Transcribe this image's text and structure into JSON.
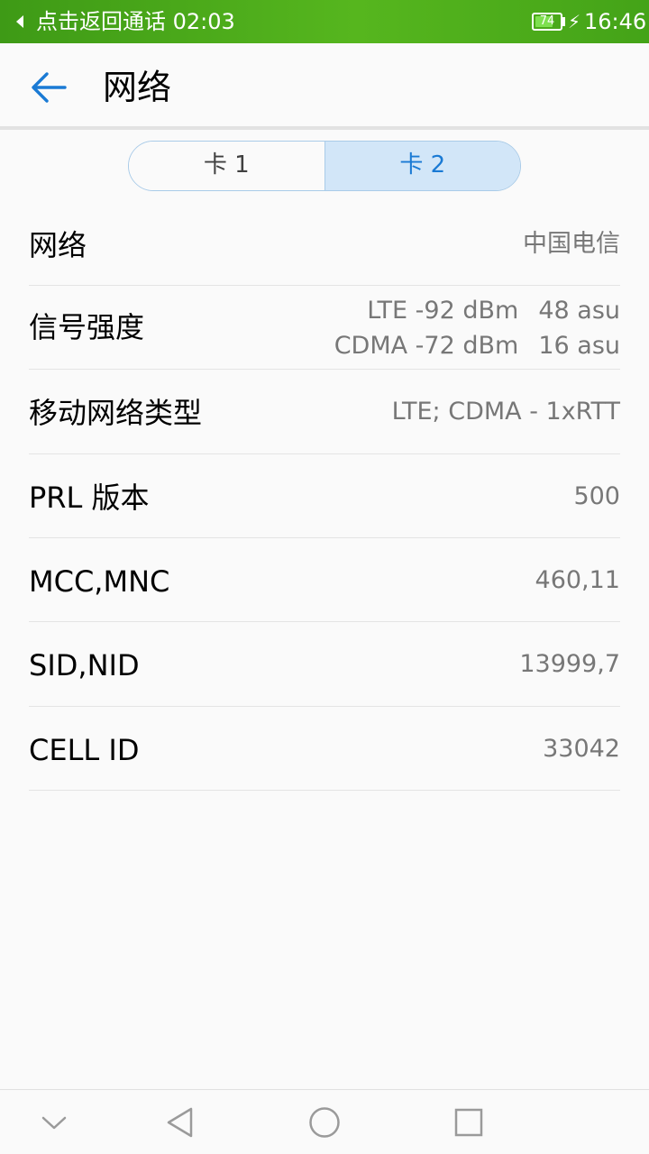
{
  "status_bar": {
    "call_text": "点击返回通话 02:03",
    "battery_level": "74",
    "time": "16:46",
    "background_color": "#4eae1c",
    "icons": [
      "back-arrow-icon",
      "battery-icon",
      "charging-bolt-icon"
    ]
  },
  "header": {
    "title": "网络",
    "back_icon": "back-arrow-icon",
    "accent_color": "#1a7ad4"
  },
  "sim_tabs": [
    {
      "label": "卡 1",
      "selected": false
    },
    {
      "label": "卡 2",
      "selected": true
    }
  ],
  "rows": [
    {
      "label": "网络",
      "value": "中国电信"
    },
    {
      "label": "信号强度",
      "lines": [
        {
          "dbm": "LTE -92 dBm",
          "asu": "48 asu"
        },
        {
          "dbm": "CDMA -72 dBm",
          "asu": "16 asu"
        }
      ]
    },
    {
      "label": "移动网络类型",
      "value": "LTE; CDMA - 1xRTT"
    },
    {
      "label": "PRL 版本",
      "value": "500"
    },
    {
      "label": "MCC,MNC",
      "value": "460,11"
    },
    {
      "label": "SID,NID",
      "value": "13999,7"
    },
    {
      "label": "CELL ID",
      "value": "33042"
    }
  ],
  "nav_bar": {
    "icons": [
      "chevron-down-icon",
      "nav-back-icon",
      "home-icon",
      "recents-icon"
    ]
  }
}
